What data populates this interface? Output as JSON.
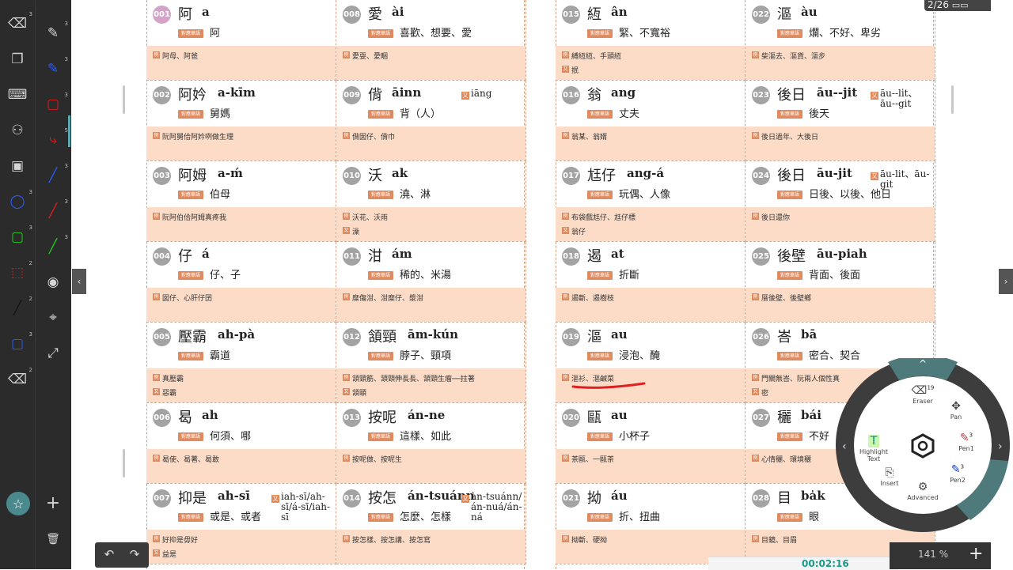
{
  "viewer": {
    "page_counter": "2/26",
    "zoom": "141 %",
    "status_time": "00:02:16",
    "prev_arrow": "‹",
    "next_arrow": "›"
  },
  "toolbar": {
    "tools": [
      {
        "icon": "eraser-icon",
        "badge": "3"
      },
      {
        "icon": "pen-gray-icon",
        "badge": "3"
      },
      {
        "icon": "copy-icon",
        "badge": ""
      },
      {
        "icon": "pen-blue-icon",
        "badge": "3"
      },
      {
        "icon": "keyboard-icon",
        "badge": ""
      },
      {
        "icon": "rect-red-icon",
        "badge": "3"
      },
      {
        "icon": "binoculars-icon",
        "badge": ""
      },
      {
        "icon": "curve-red-icon",
        "badge": "5"
      },
      {
        "icon": "save-icon",
        "badge": ""
      },
      {
        "icon": "line-blue-icon",
        "badge": "3"
      },
      {
        "icon": "ellipse-blue-icon",
        "badge": "3"
      },
      {
        "icon": "line-red-icon",
        "badge": "3"
      },
      {
        "icon": "rect-green-icon",
        "badge": "3"
      },
      {
        "icon": "line-green-icon",
        "badge": "3"
      },
      {
        "icon": "rect-red-dashed-icon",
        "badge": "2"
      },
      {
        "icon": "camera-icon",
        "badge": ""
      },
      {
        "icon": "line-black-icon",
        "badge": "2"
      },
      {
        "icon": "crosshair-icon",
        "badge": ""
      },
      {
        "icon": "rect-blue-icon",
        "badge": "3"
      },
      {
        "icon": "expand-icon",
        "badge": ""
      },
      {
        "icon": "eraser-small-icon",
        "badge": "2"
      }
    ],
    "undo": "↶",
    "redo": "↷",
    "star": "☆",
    "plus": "+",
    "trash": "🗑"
  },
  "ex_tag": "例",
  "alt_tag": "又",
  "entry_tag": "對應華語",
  "pages": [
    {
      "entries": [
        {
          "num": "001",
          "hanzi": "阿",
          "roman": "a",
          "meaning": "阿",
          "alt": "",
          "examples": [
            "阿母、阿爸"
          ]
        },
        {
          "num": "008",
          "hanzi": "愛",
          "roman": "ài",
          "meaning": "喜歡、想要、愛",
          "alt": "",
          "examples": [
            "愛耍、愛睏"
          ]
        },
        {
          "num": "002",
          "hanzi": "阿妗",
          "roman": "a-kīm",
          "meaning": "舅媽",
          "alt": "",
          "examples": [
            "阮阿舅佮阿妗咧做生理"
          ]
        },
        {
          "num": "009",
          "hanzi": "偝",
          "roman": "āinn",
          "meaning": "背（人）",
          "alt": "iāng",
          "examples": [
            "偝囡仔、偝巾"
          ]
        },
        {
          "num": "003",
          "hanzi": "阿姆",
          "roman": "a-ḿ",
          "meaning": "伯母",
          "alt": "",
          "examples": [
            "阮阿伯佮阿姆真疼我"
          ]
        },
        {
          "num": "010",
          "hanzi": "沃",
          "roman": "ak",
          "meaning": "澆、淋",
          "alt": "",
          "examples": [
            "沃花、沃雨",
            "澡"
          ]
        },
        {
          "num": "004",
          "hanzi": "仔",
          "roman": "á",
          "meaning": "仔、子",
          "alt": "",
          "examples": [
            "囡仔、心肝仔囝"
          ]
        },
        {
          "num": "011",
          "hanzi": "泔",
          "roman": "ám",
          "meaning": "稀的、米湯",
          "alt": "",
          "examples": [
            "糜傷泔、泔糜仔、漿泔"
          ]
        },
        {
          "num": "005",
          "hanzi": "壓霸",
          "roman": "ah-pà",
          "meaning": "霸道",
          "alt": "",
          "examples": [
            "真壓霸",
            "惡霸"
          ]
        },
        {
          "num": "012",
          "hanzi": "頷頸",
          "roman": "ām-kún",
          "meaning": "脖子、頸項",
          "alt": "",
          "examples": [
            "頷頸筋、頷頸伸長長、頷頸生瘤──拄著",
            "頷頤"
          ]
        },
        {
          "num": "006",
          "hanzi": "曷",
          "roman": "ah",
          "meaning": "何須、哪",
          "alt": "",
          "examples": [
            "曷使、曷著、曷敢"
          ]
        },
        {
          "num": "013",
          "hanzi": "按呢",
          "roman": "án-ne",
          "meaning": "這樣、如此",
          "alt": "",
          "examples": [
            "按呢做、按呢生"
          ]
        },
        {
          "num": "007",
          "hanzi": "抑是",
          "roman": "ah-sī",
          "meaning": "或是、或者",
          "alt": "iah-sī/ah-sī/á-sī/iah-sī",
          "examples": [
            "好抑是毋好",
            "益是"
          ]
        },
        {
          "num": "014",
          "hanzi": "按怎",
          "roman": "án-tsuánn",
          "meaning": "怎麼、怎樣",
          "alt": "àn-tsuánn/án-nuá/án-ná",
          "examples": [
            "按怎樣、按怎講、按怎寫"
          ]
        }
      ]
    },
    {
      "entries": [
        {
          "num": "015",
          "hanzi": "絚",
          "roman": "ân",
          "meaning": "緊、不寬裕",
          "alt": "",
          "examples": [
            "縛絚絚、手頭絚",
            "抿"
          ]
        },
        {
          "num": "022",
          "hanzi": "漚",
          "roman": "àu",
          "meaning": "爛、不好、卑劣",
          "alt": "",
          "examples": [
            "柴漚去、漚貨、漚步"
          ]
        },
        {
          "num": "016",
          "hanzi": "翁",
          "roman": "ang",
          "meaning": "丈夫",
          "alt": "",
          "examples": [
            "翁某、翁婿"
          ]
        },
        {
          "num": "023",
          "hanzi": "後日",
          "roman": "āu--jit",
          "meaning": "後天",
          "alt": "āu--lı̍t、āu--git",
          "examples": [
            "後日過年、大後日"
          ]
        },
        {
          "num": "017",
          "hanzi": "尪仔",
          "roman": "ang-á",
          "meaning": "玩偶、人像",
          "alt": "",
          "examples": [
            "布袋戲尪仔、尪仔標",
            "翁仔"
          ]
        },
        {
          "num": "024",
          "hanzi": "後日",
          "roman": "āu-jit",
          "meaning": "日後、以後、他日",
          "alt": "āu-lit、āu-git",
          "examples": [
            "後日還你"
          ]
        },
        {
          "num": "018",
          "hanzi": "遏",
          "roman": "at",
          "meaning": "折斷",
          "alt": "",
          "examples": [
            "遏斷、遏樹枝"
          ]
        },
        {
          "num": "025",
          "hanzi": "後壁",
          "roman": "āu-piah",
          "meaning": "背面、後面",
          "alt": "",
          "examples": [
            "厝後壁、後壁鄉"
          ]
        },
        {
          "num": "019",
          "hanzi": "漚",
          "roman": "au",
          "meaning": "浸泡、醃",
          "alt": "",
          "examples": [
            "漚衫、漚鹹菜"
          ]
        },
        {
          "num": "026",
          "hanzi": "峇",
          "roman": "bā",
          "meaning": "密合、契合",
          "alt": "",
          "examples": [
            "門關無峇、阮兩人個性真",
            "密"
          ]
        },
        {
          "num": "020",
          "hanzi": "甌",
          "roman": "au",
          "meaning": "小杯子",
          "alt": "",
          "examples": [
            "茶甌、一甌茶"
          ]
        },
        {
          "num": "027",
          "hanzi": "穲",
          "roman": "bái",
          "meaning": "不好",
          "alt": "",
          "examples": [
            "心情穲、環境穲"
          ]
        },
        {
          "num": "021",
          "hanzi": "拗",
          "roman": "áu",
          "meaning": "折、扭曲",
          "alt": "",
          "examples": [
            "拗斷、硬拗"
          ]
        },
        {
          "num": "028",
          "hanzi": "目",
          "roman": "ba̍k",
          "meaning": "眼",
          "alt": "",
          "examples": [
            "目鏡、目眉"
          ]
        }
      ]
    }
  ],
  "wheel": {
    "up": "^",
    "left": "‹",
    "right": "›",
    "eraser": {
      "label": "Eraser",
      "sup": "19"
    },
    "pan": {
      "label": "Pan"
    },
    "highlight": {
      "label": "Highlight Text",
      "icon_text": "T"
    },
    "pen1": {
      "label": "Pen1",
      "sup": "3"
    },
    "insert": {
      "label": "Insert"
    },
    "advanced": {
      "label": "Advanced"
    },
    "pen2": {
      "label": "Pen2",
      "sup": "3"
    }
  },
  "colors": {
    "accent": "#e08a5e",
    "fill": "#fcdcc7",
    "toolbar": "#2b2b2b",
    "wheel_teal": "#4f7a7c"
  }
}
